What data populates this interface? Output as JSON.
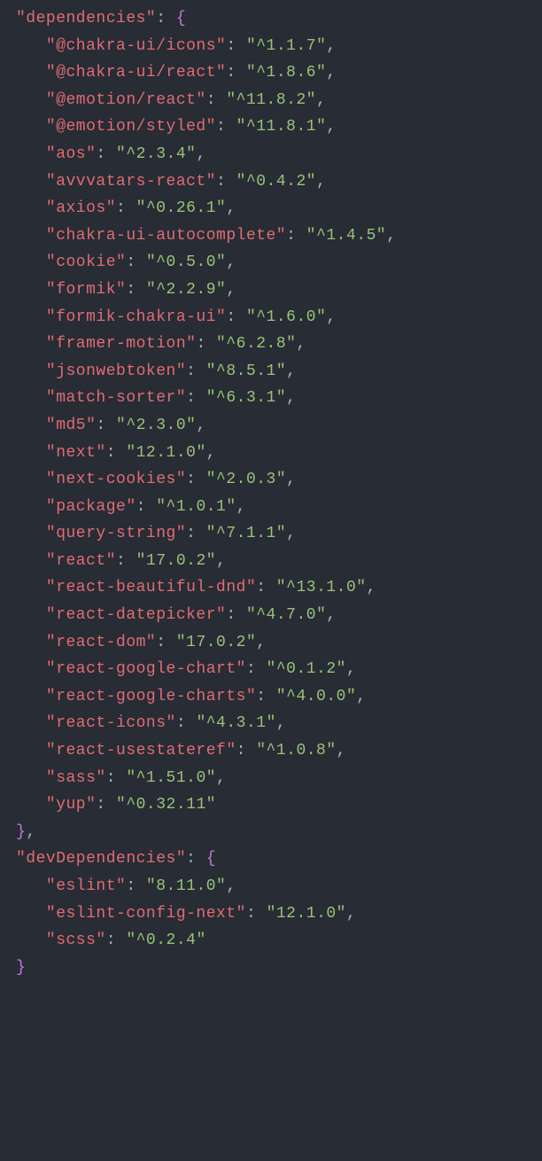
{
  "sections": [
    {
      "name": "dependencies",
      "trailingComma": true,
      "entries": [
        {
          "k": "@chakra-ui/icons",
          "v": "^1.1.7"
        },
        {
          "k": "@chakra-ui/react",
          "v": "^1.8.6"
        },
        {
          "k": "@emotion/react",
          "v": "^11.8.2"
        },
        {
          "k": "@emotion/styled",
          "v": "^11.8.1"
        },
        {
          "k": "aos",
          "v": "^2.3.4"
        },
        {
          "k": "avvvatars-react",
          "v": "^0.4.2"
        },
        {
          "k": "axios",
          "v": "^0.26.1"
        },
        {
          "k": "chakra-ui-autocomplete",
          "v": "^1.4.5"
        },
        {
          "k": "cookie",
          "v": "^0.5.0"
        },
        {
          "k": "formik",
          "v": "^2.2.9"
        },
        {
          "k": "formik-chakra-ui",
          "v": "^1.6.0"
        },
        {
          "k": "framer-motion",
          "v": "^6.2.8"
        },
        {
          "k": "jsonwebtoken",
          "v": "^8.5.1"
        },
        {
          "k": "match-sorter",
          "v": "^6.3.1"
        },
        {
          "k": "md5",
          "v": "^2.3.0"
        },
        {
          "k": "next",
          "v": "12.1.0"
        },
        {
          "k": "next-cookies",
          "v": "^2.0.3"
        },
        {
          "k": "package",
          "v": "^1.0.1"
        },
        {
          "k": "query-string",
          "v": "^7.1.1"
        },
        {
          "k": "react",
          "v": "17.0.2"
        },
        {
          "k": "react-beautiful-dnd",
          "v": "^13.1.0"
        },
        {
          "k": "react-datepicker",
          "v": "^4.7.0"
        },
        {
          "k": "react-dom",
          "v": "17.0.2"
        },
        {
          "k": "react-google-chart",
          "v": "^0.1.2"
        },
        {
          "k": "react-google-charts",
          "v": "^4.0.0"
        },
        {
          "k": "react-icons",
          "v": "^4.3.1"
        },
        {
          "k": "react-usestateref",
          "v": "^1.0.8"
        },
        {
          "k": "sass",
          "v": "^1.51.0"
        },
        {
          "k": "yup",
          "v": "^0.32.11"
        }
      ]
    },
    {
      "name": "devDependencies",
      "trailingComma": false,
      "entries": [
        {
          "k": "eslint",
          "v": "8.11.0"
        },
        {
          "k": "eslint-config-next",
          "v": "12.1.0"
        },
        {
          "k": "scss",
          "v": "^0.2.4"
        }
      ]
    }
  ]
}
